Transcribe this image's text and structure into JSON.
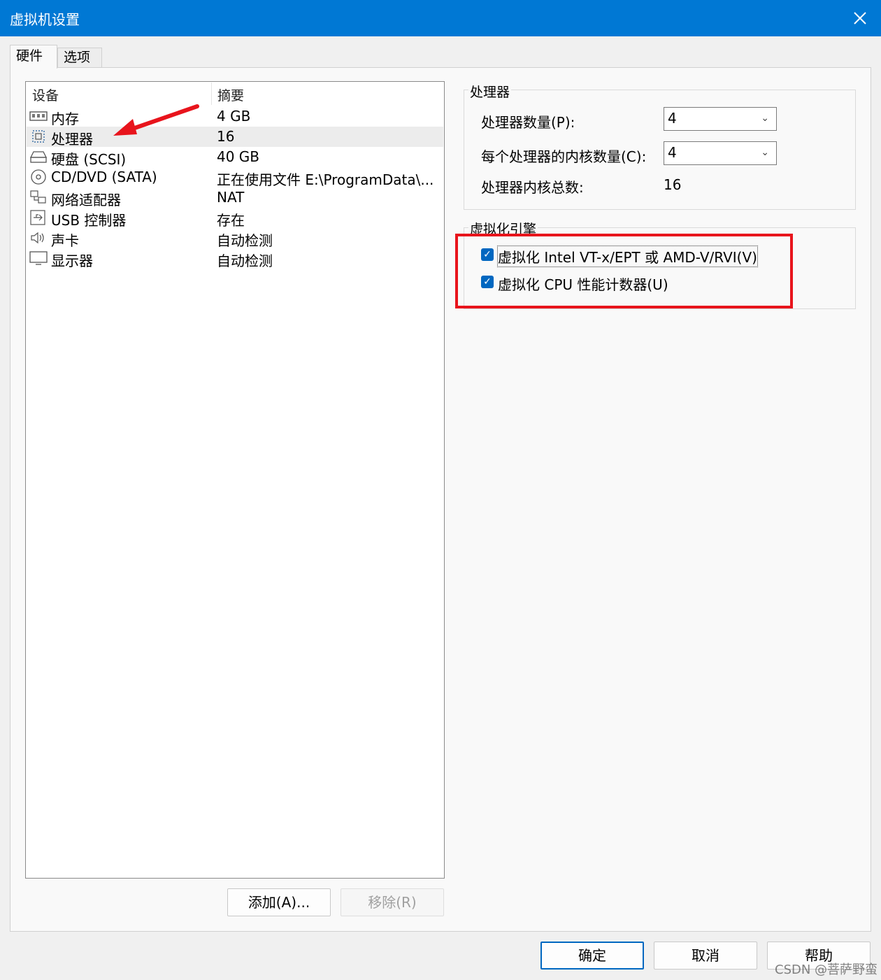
{
  "window": {
    "title": "虚拟机设置"
  },
  "tabs": [
    {
      "label": "硬件"
    },
    {
      "label": "选项"
    }
  ],
  "device_list": {
    "col_device": "设备",
    "col_summary": "摘要",
    "rows": [
      {
        "icon": "memory-icon",
        "name": "内存",
        "summary": "4 GB"
      },
      {
        "icon": "processor-icon",
        "name": "处理器",
        "summary": "16"
      },
      {
        "icon": "hard-disk-icon",
        "name": "硬盘 (SCSI)",
        "summary": "40 GB"
      },
      {
        "icon": "cd-dvd-icon",
        "name": "CD/DVD (SATA)",
        "summary": "正在使用文件 E:\\ProgramData\\..."
      },
      {
        "icon": "network-adapter-icon",
        "name": "网络适配器",
        "summary": "NAT"
      },
      {
        "icon": "usb-icon",
        "name": "USB 控制器",
        "summary": "存在"
      },
      {
        "icon": "sound-icon",
        "name": "声卡",
        "summary": "自动检测"
      },
      {
        "icon": "display-icon",
        "name": "显示器",
        "summary": "自动检测"
      }
    ],
    "selected_index": 1
  },
  "list_buttons": {
    "add": "添加(A)...",
    "remove": "移除(R)"
  },
  "processor_group": {
    "title": "处理器",
    "count_label": "处理器数量(P):",
    "count_value": "4",
    "cores_label": "每个处理器的内核数量(C):",
    "cores_value": "4",
    "total_label": "处理器内核总数:",
    "total_value": "16"
  },
  "virt_group": {
    "title": "虚拟化引擎",
    "opt1_label": "虚拟化 Intel VT-x/EPT 或 AMD-V/RVI(V)",
    "opt1_checked": true,
    "opt2_label": "虚拟化 CPU 性能计数器(U)",
    "opt2_checked": true
  },
  "footer": {
    "ok": "确定",
    "cancel": "取消",
    "help": "帮助"
  },
  "watermark": "CSDN @菩萨野蛮",
  "colors": {
    "titlebar": "#0078d4",
    "accent": "#0067c0",
    "annotation": "#e8141c"
  }
}
